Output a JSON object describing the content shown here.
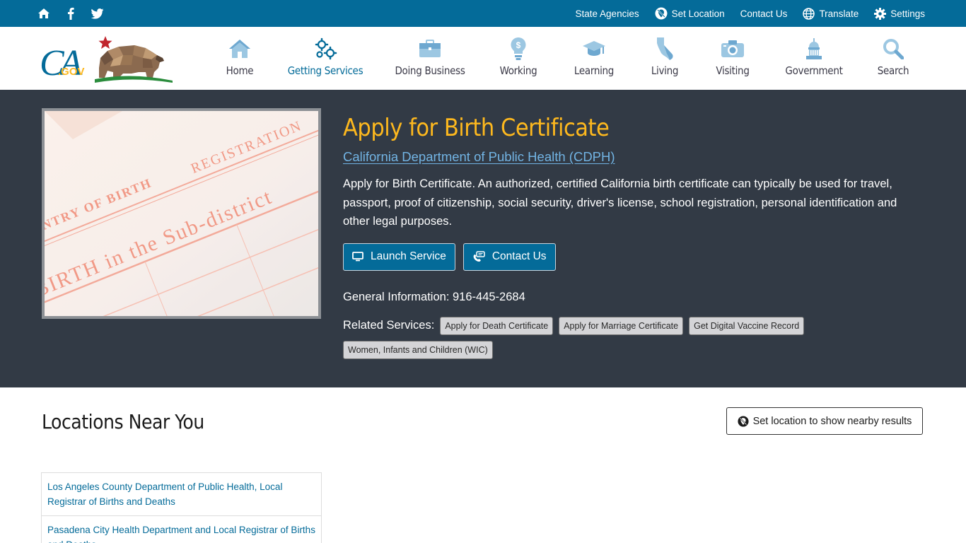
{
  "utility": {
    "state_agencies": "State Agencies",
    "set_location": "Set Location",
    "contact_us": "Contact Us",
    "translate": "Translate",
    "settings": "Settings"
  },
  "nav": {
    "items": [
      {
        "label": "Home",
        "icon": "home-icon"
      },
      {
        "label": "Getting Services",
        "icon": "gears-icon",
        "active": true
      },
      {
        "label": "Doing Business",
        "icon": "briefcase-icon"
      },
      {
        "label": "Working",
        "icon": "lightbulb-icon"
      },
      {
        "label": "Learning",
        "icon": "graduation-cap-icon"
      },
      {
        "label": "Living",
        "icon": "california-icon"
      },
      {
        "label": "Visiting",
        "icon": "camera-icon"
      },
      {
        "label": "Government",
        "icon": "capitol-icon"
      },
      {
        "label": "Search",
        "icon": "search-icon"
      }
    ]
  },
  "logo": {
    "text": "CA.GOV"
  },
  "hero": {
    "title": "Apply for Birth Certificate",
    "department": "California Department of Public Health (CDPH)",
    "description": "Apply for Birth Certificate. An authorized, certified California birth certificate can typically be used for travel, passport, proof of citizenship, social security, driver's license, school registration, personal identification and other legal purposes.",
    "launch_label": "Launch Service",
    "contact_label": "Contact Us",
    "general_info": "General Information: 916-445-2684",
    "related_label": "Related Services:",
    "related": [
      "Apply for Death Certificate",
      "Apply for Marriage Certificate",
      "Get Digital Vaccine Record",
      "Women, Infants and Children (WIC)"
    ],
    "image_text": {
      "line1": "ENTRY OF BIRTH",
      "line2": "REGISTRATION",
      "line3": "BIRTH in the Sub-district"
    }
  },
  "locations": {
    "title": "Locations Near You",
    "set_location_label": "Set location to show nearby results",
    "items": [
      "Los Angeles County Department of Public Health, Local Registrar of Births and Deaths",
      "Pasadena City Health Department and Local Registrar of Births and Deaths"
    ]
  },
  "colors": {
    "utility_bar": "#046b99",
    "hero_bg": "#323a45",
    "title": "#fdb81e",
    "link": "#72b4e4"
  }
}
